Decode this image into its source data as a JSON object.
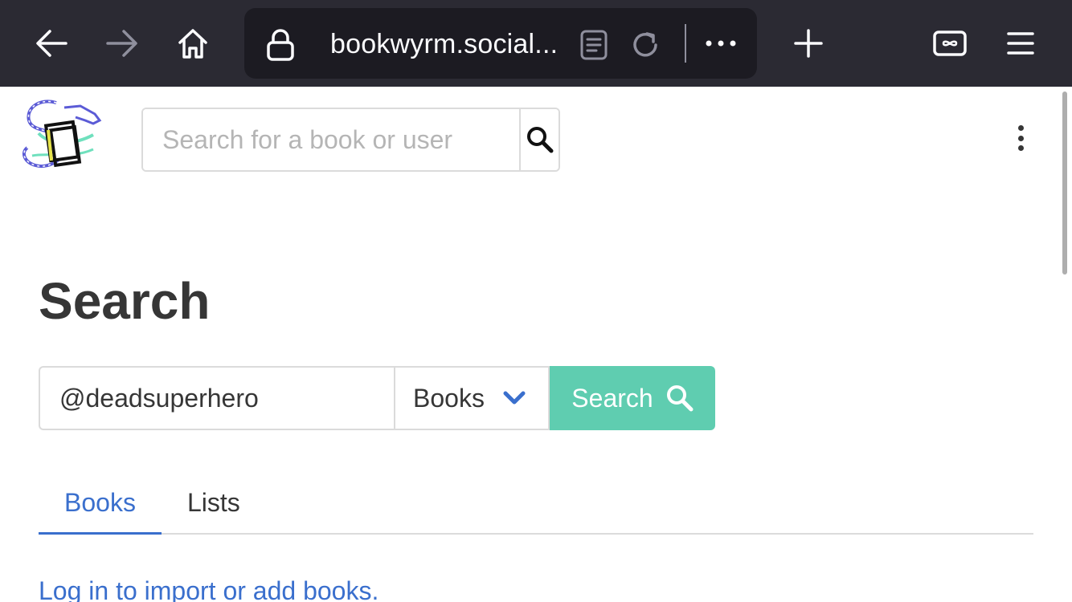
{
  "browser": {
    "url": "bookwyrm.social...",
    "icons": [
      "back-arrow-icon",
      "forward-arrow-icon",
      "home-icon",
      "lock-icon",
      "reader-mode-icon",
      "reload-icon",
      "more-dots-icon",
      "new-tab-plus-icon",
      "tabs-icon",
      "menu-hamburger-icon"
    ]
  },
  "header": {
    "search_placeholder": "Search for a book or user",
    "search_icon": "search-icon",
    "menu_icon": "kebab-menu-icon"
  },
  "main": {
    "title": "Search",
    "query_value": "@deadsuperhero",
    "type_select": "Books",
    "search_button": "Search",
    "tabs": [
      {
        "label": "Books",
        "active": true
      },
      {
        "label": "Lists",
        "active": false
      }
    ],
    "login_link": "Log in to import or add books."
  },
  "colors": {
    "toolbar_bg": "#2b2a33",
    "urlbar_bg": "#1c1b22",
    "accent_teal": "#5fcdb0",
    "link_blue": "#3a6fcd"
  }
}
